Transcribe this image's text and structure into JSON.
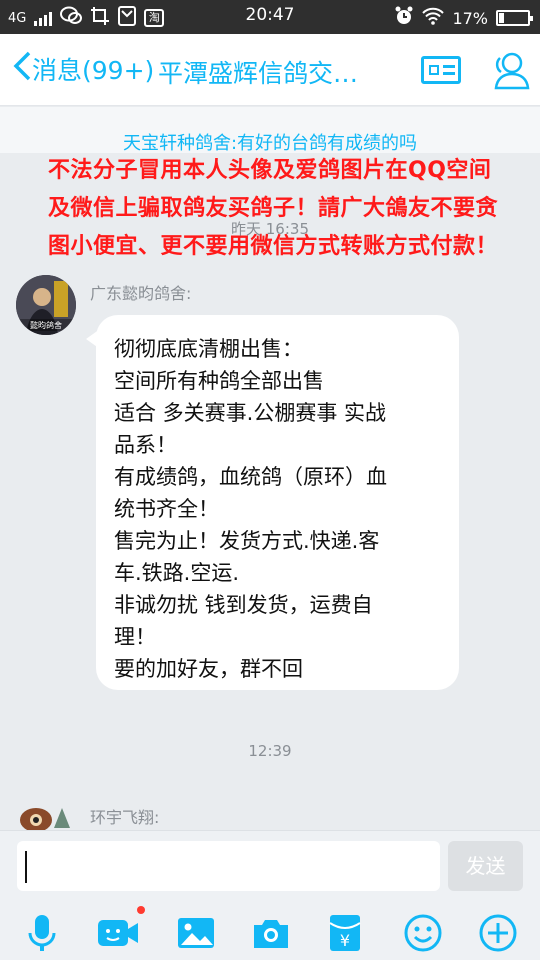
{
  "status_bar": {
    "network": "4G",
    "time": "20:47",
    "battery": "17%",
    "battery_level": 0.17,
    "notif_icon_label": "淘"
  },
  "header": {
    "back_label": "消息(99+)",
    "title": "平潭盛辉信鸽交…"
  },
  "notice": {
    "text": "天宝轩种鸽舍:有好的台鸽有成绩的吗",
    "overlay_warning": [
      "不法分子冒用本人头像及爱鸽图片在QQ空间",
      "及微信上骗取鸽友买鸽子！請广大鴿友不要贪",
      "图小便宜、更不要用微信方式转账方式付款！"
    ]
  },
  "messages": [
    {
      "time": "昨天 16:35",
      "sender": "广东懿昀鸽舍:",
      "avatar_caption": "懿昀鸽舍",
      "lines": [
        "彻彻底底清棚出售：",
        "空间所有种鸽全部出售",
        "适合 多关赛事.公棚赛事 实战",
        "品系！",
        "有成绩鸽，血统鸽（原环）血",
        "统书齐全！",
        "售完为止！发货方式.快递.客",
        "车.铁路.空运.",
        "非诚勿扰 钱到发货，运费自",
        "理！",
        "要的加好友，群不回"
      ]
    },
    {
      "time": "12:39",
      "sender": "环宇飞翔:"
    }
  ],
  "input": {
    "value": "",
    "send_label": "发送"
  },
  "toolbar": {
    "icons": [
      "microphone-icon",
      "video-icon",
      "image-icon",
      "camera-icon",
      "red-packet-icon",
      "emoji-icon",
      "plus-icon"
    ],
    "red_packet_char": "¥"
  },
  "colors": {
    "accent": "#12b7f5",
    "warning": "#ff1a1a",
    "background": "#e9ecef"
  }
}
